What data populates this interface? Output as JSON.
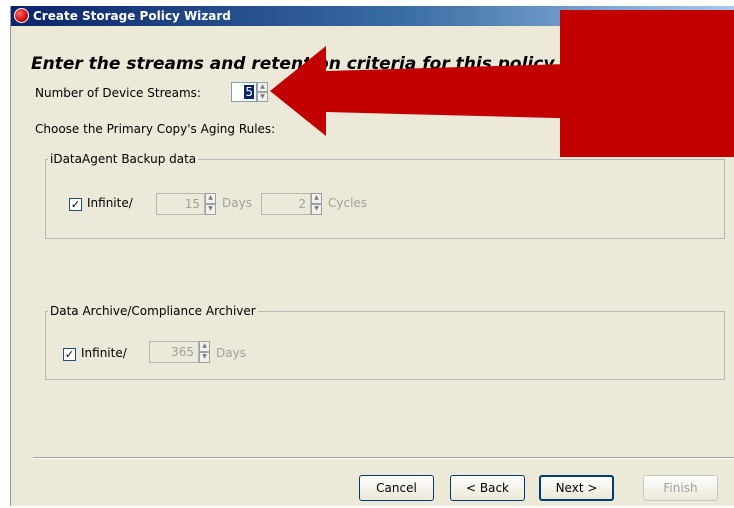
{
  "window": {
    "title": "Create Storage Policy Wizard"
  },
  "heading": "Enter the streams and retention criteria for this policy",
  "streams": {
    "label": "Number of Device Streams:",
    "value": "5"
  },
  "aging_label": "Choose the Primary Copy's Aging Rules:",
  "backup_group": {
    "title": "iDataAgent Backup data",
    "infinite_label": "Infinite/",
    "infinite_checked": true,
    "days_value": "15",
    "days_label": "Days",
    "cycles_value": "2",
    "cycles_label": "Cycles"
  },
  "archive_group": {
    "title": "Data Archive/Compliance Archiver",
    "infinite_label": "Infinite/",
    "infinite_checked": true,
    "days_value": "365",
    "days_label": "Days"
  },
  "buttons": {
    "cancel": "Cancel",
    "back": "< Back",
    "next": "Next >",
    "finish": "Finish"
  },
  "annotation": {
    "color": "#c20000"
  }
}
